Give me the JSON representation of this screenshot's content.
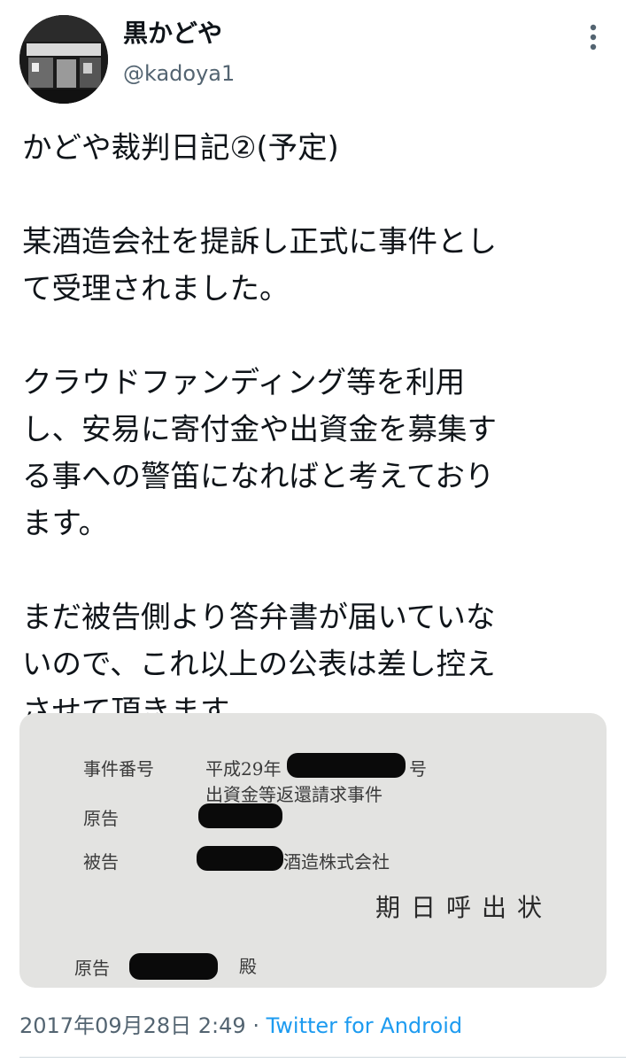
{
  "author": {
    "display_name": "黒かどや",
    "handle": "@kadoya1",
    "avatar_icon": "storefront-photo-avatar"
  },
  "menu": {
    "icon": "more-vertical-icon"
  },
  "tweet": {
    "title": "かどや裁判日記②(予定)",
    "para1_line1": "某酒造会社を提訴し正式に事件とし",
    "para1_line2": "て受理されました。",
    "para2_line1": "クラウドファンディング等を利用",
    "para2_line2": "し、安易に寄付金や出資金を募集す",
    "para2_line3": "る事への警笛になればと考えており",
    "para2_line4": "ます。",
    "para3_line1": "まだ被告側より答弁書が届いていな",
    "para3_line2": "いので、これ以上の公表は差し控え",
    "para3_line3": "させて頂きます。"
  },
  "document_photo": {
    "case_number_label": "事件番号",
    "case_number_value": "平成29年",
    "case_number_suffix": "号",
    "case_name": "出資金等返還請求事件",
    "plaintiff_label": "原告",
    "defendant_label": "被告",
    "defendant_value": "酒造株式会社",
    "summons_title": "期日呼出状",
    "addressee_label": "原告",
    "addressee_suffix": "殿"
  },
  "meta": {
    "timestamp": "2017年09月28日 2:49",
    "separator": "·",
    "source": "Twitter for Android"
  },
  "colors": {
    "text": "#0f1419",
    "secondary": "#536471",
    "link": "#1d9bf0",
    "photo_bg": "#e3e3e1"
  }
}
